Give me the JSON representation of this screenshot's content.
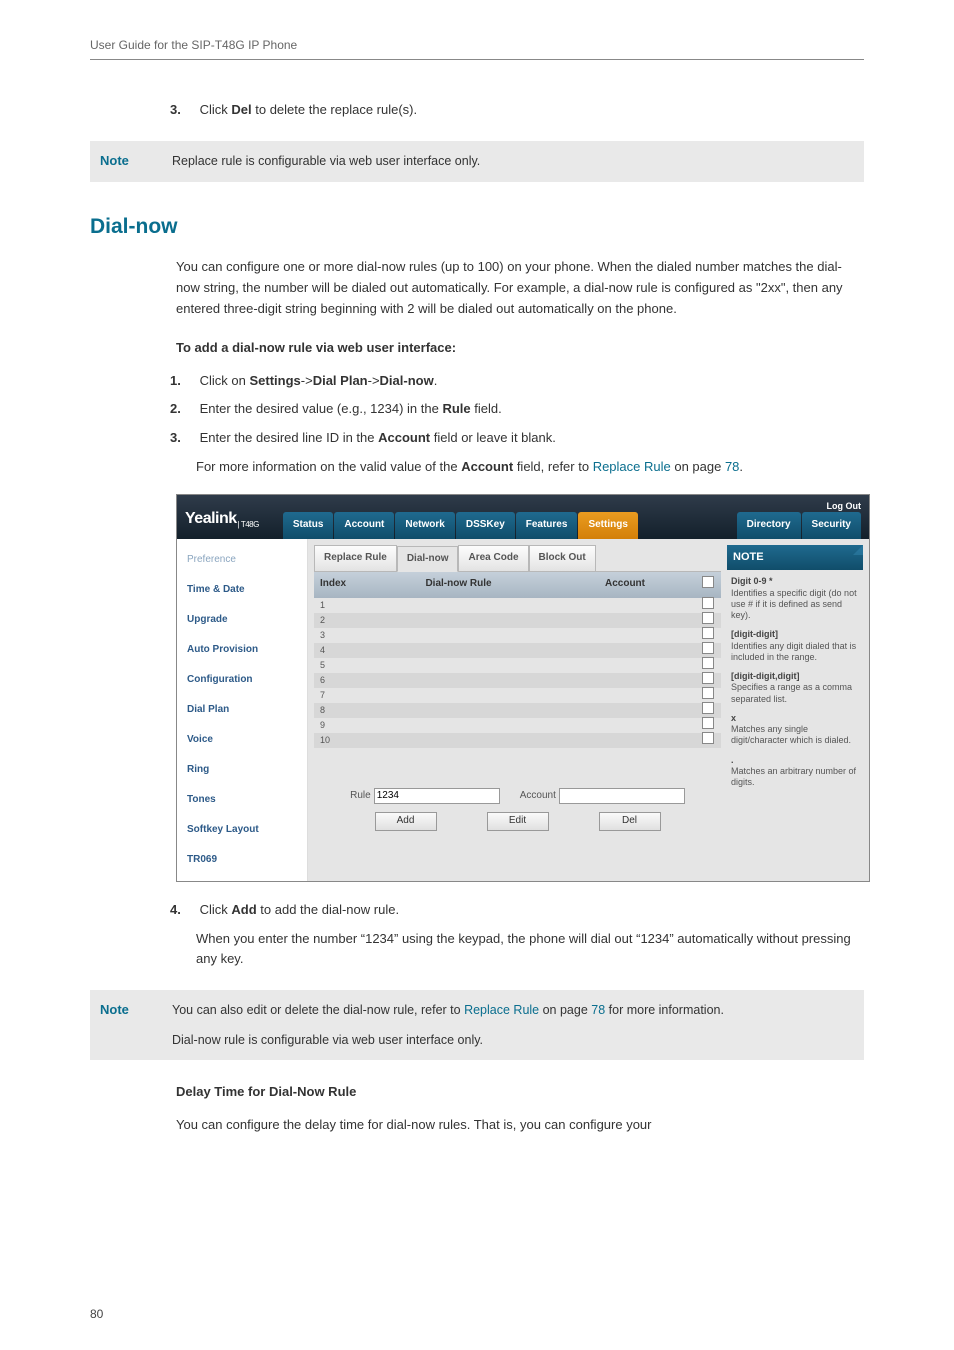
{
  "header": "User Guide for the SIP-T48G IP Phone",
  "page_number": "80",
  "step_del": {
    "num": "3.",
    "pre": "Click ",
    "bold": "Del",
    "post": " to delete the replace rule(s)."
  },
  "note1": {
    "label": "Note",
    "text": "Replace rule is configurable via web user interface only."
  },
  "section_title": "Dial-now",
  "intro": "You can configure one or more dial-now rules (up to 100) on your phone. When the dialed number matches the dial-now string, the number will be dialed out automatically. For example, a dial-now rule is configured as \"2xx\", then any entered three-digit string beginning with 2 will be dialed out automatically on the phone.",
  "to_add": "To add a dial-now rule via web user interface:",
  "s1": {
    "num": "1.",
    "a": "Click on ",
    "b1": "Settings",
    "arrow1": "->",
    "b2": "Dial Plan",
    "arrow2": "->",
    "b3": "Dial-now",
    "dot": "."
  },
  "s2": {
    "num": "2.",
    "a": "Enter the desired value (e.g., 1234) in the ",
    "b": "Rule",
    "c": " field."
  },
  "s3": {
    "num": "3.",
    "a": "Enter the desired line ID in the ",
    "b": "Account",
    "c": " field or leave it blank."
  },
  "s3b": {
    "a": "For more information on the valid value of the ",
    "b": "Account",
    "c": " field, refer to ",
    "link": "Replace Rule",
    "d": " on page ",
    "page_link": "78",
    "dot": "."
  },
  "screenshot": {
    "logo": "Yealink",
    "logo_sub": "| T48G",
    "logout": "Log Out",
    "top_tabs": [
      "Status",
      "Account",
      "Network",
      "DSSKey",
      "Features",
      "Settings"
    ],
    "top_tabs_right": [
      "Directory",
      "Security"
    ],
    "top_active": "Settings",
    "sidebar": [
      {
        "label": "Preference",
        "muted": true
      },
      {
        "label": "Time & Date",
        "muted": false
      },
      {
        "label": "Upgrade",
        "muted": false
      },
      {
        "label": "Auto Provision",
        "muted": false
      },
      {
        "label": "Configuration",
        "muted": false
      },
      {
        "label": "Dial Plan",
        "muted": false
      },
      {
        "label": "Voice",
        "muted": false
      },
      {
        "label": "Ring",
        "muted": false
      },
      {
        "label": "Tones",
        "muted": false
      },
      {
        "label": "Softkey Layout",
        "muted": false
      },
      {
        "label": "TR069",
        "muted": false
      }
    ],
    "sub_tabs": [
      "Replace Rule",
      "Dial-now",
      "Area Code",
      "Block Out"
    ],
    "sub_active": "Dial-now",
    "cols": {
      "index": "Index",
      "rule": "Dial-now Rule",
      "account": "Account"
    },
    "rows": [
      "1",
      "2",
      "3",
      "4",
      "5",
      "6",
      "7",
      "8",
      "9",
      "10"
    ],
    "form": {
      "rule_label": "Rule",
      "rule_value": "1234",
      "acct_label": "Account"
    },
    "buttons": {
      "add": "Add",
      "edit": "Edit",
      "del": "Del"
    },
    "note": {
      "head": "NOTE",
      "items": [
        {
          "k": "Digit 0-9 *",
          "v": "Identifies a specific digit (do not use # if it is defined as send key)."
        },
        {
          "k": "[digit-digit]",
          "v": "Identifies any digit dialed that is included in the range."
        },
        {
          "k": "[digit-digit,digit]",
          "v": "Specifies a range as a comma separated list."
        },
        {
          "k": "x",
          "v": "Matches any single digit/character which is dialed."
        },
        {
          "k": ".",
          "v": "Matches an arbitrary number of digits."
        }
      ]
    }
  },
  "s4": {
    "num": "4.",
    "a": "Click ",
    "b": "Add",
    "c": " to add the dial-now rule."
  },
  "s4b": "When you enter the number “1234” using the keypad, the phone will dial out “1234” automatically without pressing any key.",
  "note2": {
    "label": "Note",
    "a": "You can also edit or delete the dial-now rule, refer to ",
    "link": "Replace Rule",
    "b": " on page ",
    "page_link": "78",
    "c": " for more information.",
    "secondary": "Dial-now rule is configurable via web user interface only."
  },
  "delay_title": "Delay Time for Dial-Now Rule",
  "delay_body": "You can configure the delay time for dial-now rules. That is, you can configure your"
}
